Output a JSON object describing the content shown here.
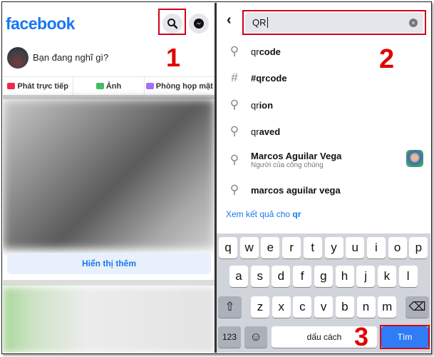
{
  "left": {
    "logo": "facebook",
    "step_number": "1",
    "composer_prompt": "Bạn đang nghĩ gì?",
    "actions": [
      {
        "label": "Phát trực tiếp",
        "icon": "live-video-icon",
        "color": "#f02849"
      },
      {
        "label": "Ảnh",
        "icon": "photo-icon",
        "color": "#45bd62"
      },
      {
        "label": "Phòng họp mặt",
        "icon": "room-icon",
        "color": "#a56ef7"
      }
    ],
    "show_more": "Hiển thị thêm"
  },
  "right": {
    "search_value": "QR",
    "step_number": "2",
    "suggestions": [
      {
        "prefix": "qr ",
        "bold": "code",
        "icon": "search-icon"
      },
      {
        "prefix": "",
        "bold": "#qrcode",
        "icon": "hashtag-icon"
      },
      {
        "prefix": "qr",
        "bold": "ion",
        "icon": "search-icon"
      },
      {
        "prefix": "qr",
        "bold": "aved",
        "icon": "search-icon"
      },
      {
        "prefix": "",
        "bold": "Marcos Aguilar Vega",
        "subtitle": "Người của công chúng",
        "icon": "search-icon"
      },
      {
        "prefix": "",
        "bold": "marcos aguilar vega",
        "icon": "search-icon"
      }
    ],
    "see_all_prefix": "Xem kết quả cho ",
    "see_all_query": "qr",
    "keyboard": {
      "row1": [
        "q",
        "w",
        "e",
        "r",
        "t",
        "y",
        "u",
        "i",
        "o",
        "p"
      ],
      "row2": [
        "a",
        "s",
        "d",
        "f",
        "g",
        "h",
        "j",
        "k",
        "l"
      ],
      "row3": [
        "z",
        "x",
        "c",
        "v",
        "b",
        "n",
        "m"
      ],
      "numbers": "123",
      "space": "dấu cách",
      "search": "Tìm"
    },
    "step_number_3": "3"
  },
  "colors": {
    "brand": "#1877f2",
    "annotation": "#e00000"
  }
}
